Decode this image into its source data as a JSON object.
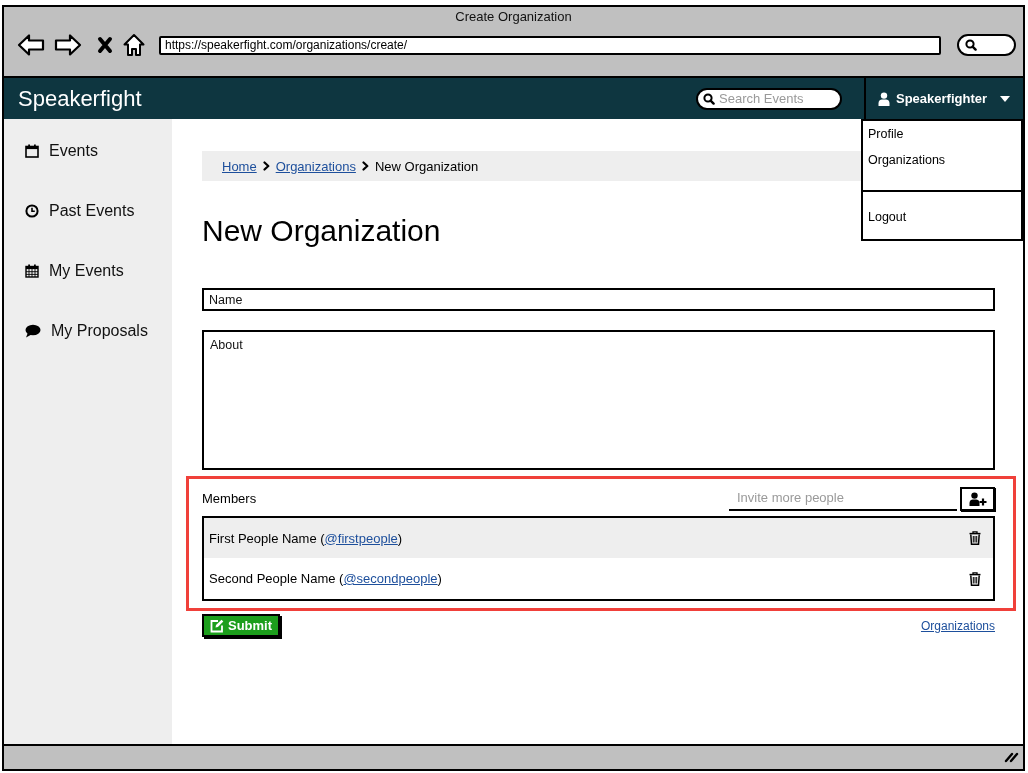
{
  "window": {
    "title": "Create Organization",
    "url": "https://speakerfight.com/organizations/create/"
  },
  "navbar": {
    "brand": "Speakerfight",
    "search": {
      "placeholder": "Search Events"
    },
    "user": {
      "name": "Speakerfighter",
      "expanded": true
    },
    "user_menu": {
      "groups": [
        {
          "items": [
            "Profile",
            "Organizations"
          ]
        },
        {
          "items": [
            "Logout"
          ]
        }
      ]
    }
  },
  "sidebar": {
    "items": [
      {
        "label": "Events",
        "kind": "calendar"
      },
      {
        "label": "Past Events",
        "kind": "clock"
      },
      {
        "label": "My Events",
        "kind": "schedule"
      },
      {
        "label": "My Proposals",
        "kind": "comment"
      }
    ]
  },
  "breadcrumb": [
    {
      "label": "Home",
      "kind": "link"
    },
    {
      "label": "Organizations",
      "kind": "link"
    },
    {
      "label": "New Organization",
      "kind": "current"
    }
  ],
  "page": {
    "heading": "New Organization",
    "fields": [
      {
        "kind": "line",
        "placeholder": "Name"
      },
      {
        "kind": "area",
        "placeholder": "About"
      }
    ],
    "members": {
      "label": "Members",
      "highlighted": true,
      "invite": {
        "placeholder": "Invite more people"
      },
      "rows": [
        {
          "name": "First People Name (",
          "handle": "@firstpeople",
          "tail": ")"
        },
        {
          "name": "Second People Name (",
          "handle": "@secondpeople",
          "tail": ")"
        }
      ]
    },
    "submit": "Submit",
    "back_link": "Organizations"
  }
}
